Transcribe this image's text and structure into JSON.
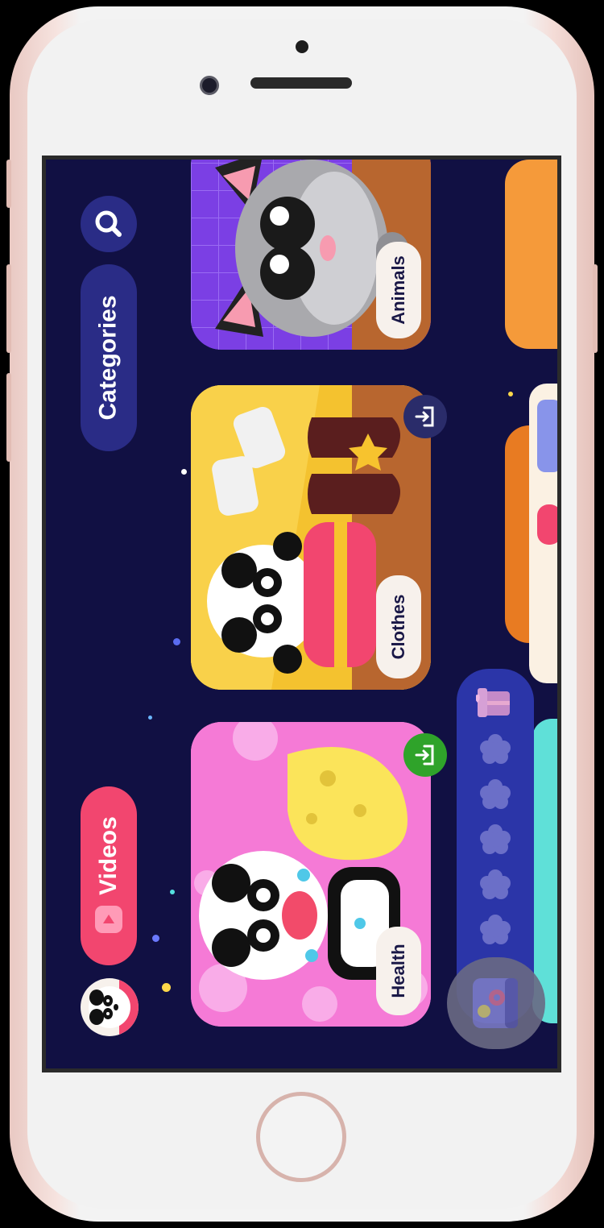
{
  "nav": {
    "categories_label": "Categories",
    "videos_label": "Videos"
  },
  "cards": [
    {
      "label": "Animals",
      "color": "#7b3fe4"
    },
    {
      "label": "Clothes",
      "color": "#f4c22f"
    },
    {
      "label": "Health",
      "color": "#f57ad6"
    }
  ],
  "progress": {
    "stars_total": 5,
    "stars_filled": 0
  },
  "colors": {
    "background": "#111043",
    "videos_pill": "#f2466f",
    "categories_pill": "#2a2c86",
    "enter_active": "#2fa32a"
  },
  "icons": [
    "search-icon",
    "play-icon",
    "enter-icon",
    "gift-icon",
    "star-icon",
    "panda-avatar-icon",
    "sticker-album-icon"
  ]
}
